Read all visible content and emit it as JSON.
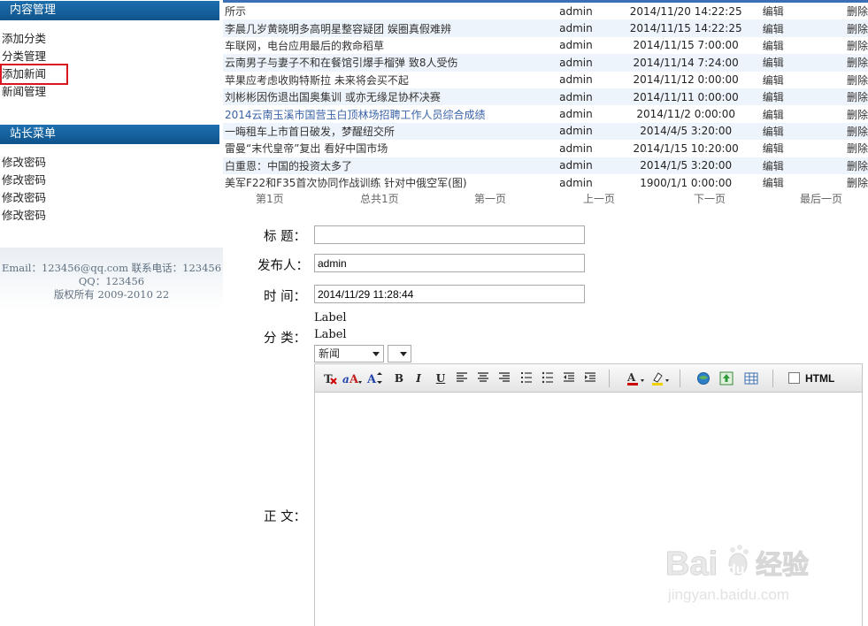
{
  "sidebar": {
    "content_header": "内容管理",
    "content_items": [
      {
        "label": "添加分类"
      },
      {
        "label": "分类管理"
      },
      {
        "label": "添加新闻"
      },
      {
        "label": "新闻管理"
      }
    ],
    "site_header": "站长菜单",
    "site_items": [
      {
        "label": "修改密码"
      },
      {
        "label": "修改密码"
      },
      {
        "label": "修改密码"
      },
      {
        "label": "修改密码"
      }
    ],
    "footer": {
      "line1": "Email：123456@qq.com 联系电话：123456",
      "line2": "QQ：123456",
      "line3": "版权所有  2009-2010 22"
    }
  },
  "news": {
    "rows": [
      {
        "title": "所示",
        "publisher": "admin",
        "time": "2014/11/20 14:22:25",
        "edit": "编辑",
        "delete": "删除"
      },
      {
        "title": "李晨几岁黄晓明多高明星整容疑团 娱圈真假难辨",
        "publisher": "admin",
        "time": "2014/11/15 14:22:25",
        "edit": "编辑",
        "delete": "删除"
      },
      {
        "title": "车联网，电台应用最后的救命稻草",
        "publisher": "admin",
        "time": "2014/11/15 7:00:00",
        "edit": "编辑",
        "delete": "删除"
      },
      {
        "title": "云南男子与妻子不和在餐馆引爆手榴弹 致8人受伤",
        "publisher": "admin",
        "time": "2014/11/14 7:24:00",
        "edit": "编辑",
        "delete": "删除"
      },
      {
        "title": "苹果应考虑收购特斯拉 未来将会买不起",
        "publisher": "admin",
        "time": "2014/11/12 0:00:00",
        "edit": "编辑",
        "delete": "删除"
      },
      {
        "title": "刘彬彬因伤退出国奥集训 或亦无缘足协杯决赛",
        "publisher": "admin",
        "time": "2014/11/11 0:00:00",
        "edit": "编辑",
        "delete": "删除"
      },
      {
        "title": "2014云南玉溪市国营玉白顶林场招聘工作人员综合成绩",
        "publisher": "admin",
        "time": "2014/11/2 0:00:00",
        "edit": "编辑",
        "delete": "删除"
      },
      {
        "title": "一晦租车上市首日破发，梦醒纽交所",
        "publisher": "admin",
        "time": "2014/4/5 3:20:00",
        "edit": "编辑",
        "delete": "删除"
      },
      {
        "title": "雷曼“末代皇帝”复出 看好中国市场",
        "publisher": "admin",
        "time": "2014/1/15 10:20:00",
        "edit": "编辑",
        "delete": "删除"
      },
      {
        "title": "白重恩：中国的投资太多了",
        "publisher": "admin",
        "time": "2014/1/5 3:20:00",
        "edit": "编辑",
        "delete": "删除"
      },
      {
        "title": "美军F22和F35首次协同作战训练 针对中俄空军(图)",
        "publisher": "admin",
        "time": "1900/1/1 0:00:00",
        "edit": "编辑",
        "delete": "删除"
      }
    ]
  },
  "pager": {
    "current": "第1页",
    "total": "总共1页",
    "first": "第一页",
    "prev": "上一页",
    "next": "下一页",
    "last": "最后一页"
  },
  "form": {
    "title_label": "标  题：",
    "title_value": "",
    "publisher_label": "发布人：",
    "publisher_value": "admin",
    "time_label": "时  间：",
    "time_value": "2014/11/29 11:28:44",
    "category_label": "分  类：",
    "label1": "Label",
    "label2": "Label",
    "category_select": "新闻",
    "sub_select": "",
    "body_label": "正  文："
  },
  "editor": {
    "html_toggle": "HTML",
    "icons": [
      "clear-format-icon",
      "font-color-pen-icon",
      "font-size-icon",
      "bold-icon",
      "italic-icon",
      "underline-icon",
      "align-left-icon",
      "align-center-icon",
      "align-right-icon",
      "ordered-list-icon",
      "unordered-list-icon",
      "outdent-icon",
      "indent-icon",
      "text-color-icon",
      "highlight-color-icon",
      "insert-link-icon",
      "insert-image-icon",
      "insert-table-icon"
    ]
  },
  "watermark": {
    "brand": "Bai",
    "brand2": "du",
    "cn": "经验",
    "url": "jingyan.baidu.com"
  }
}
